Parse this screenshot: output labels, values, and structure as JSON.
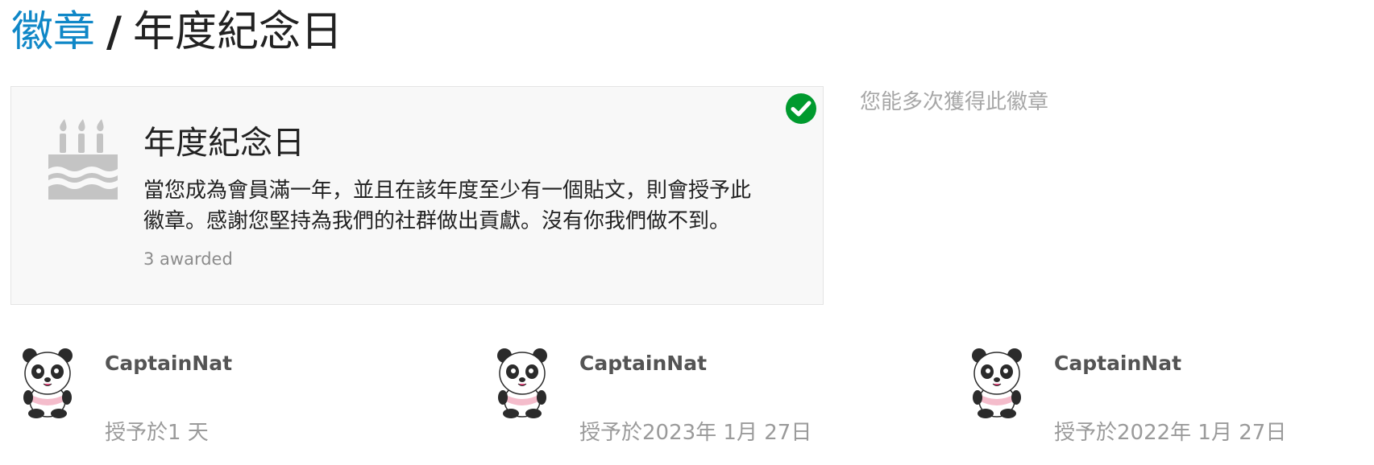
{
  "breadcrumb": {
    "parent_label": "徽章",
    "separator": "/",
    "current_label": "年度紀念日"
  },
  "badge": {
    "title": "年度紀念日",
    "description_line1": "當您成為會員滿一年，並且在該年度至少有一個貼文，則會授予此",
    "description_line2": "徽章。感謝您堅持為我們的社群做出貢獻。沒有你我們做不到。",
    "awarded_count": "3 awarded",
    "icon": "birthday-cake-icon",
    "granted_icon": "check-circle-icon",
    "icon_color": "#c4c4c4",
    "granted_color": "#009a2e"
  },
  "side_note": "您能多次獲得此徽章",
  "awards": [
    {
      "username": "CaptainNat",
      "granted": "授予於1 天"
    },
    {
      "username": "CaptainNat",
      "granted": "授予於2023年 1月 27日"
    },
    {
      "username": "CaptainNat",
      "granted": "授予於2022年 1月 27日"
    }
  ],
  "colors": {
    "link": "#0f87c7",
    "card_background": "#f8f8f8",
    "muted_text": "#9a9a9a"
  }
}
